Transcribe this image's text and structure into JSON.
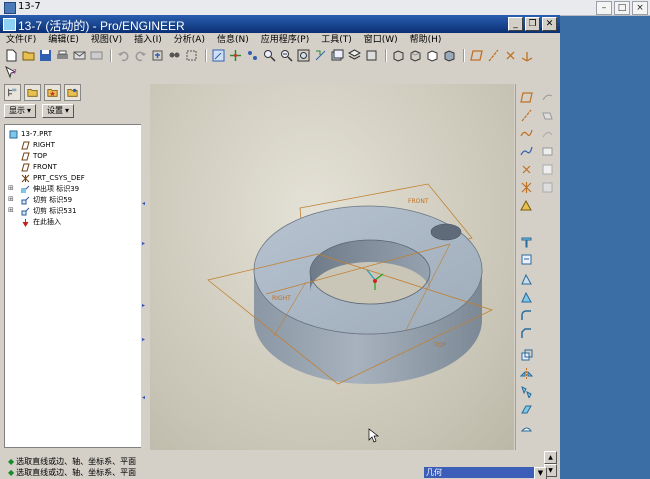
{
  "outer_window": {
    "title": "13-7"
  },
  "window": {
    "title": "13-7 (活动的) - Pro/ENGINEER"
  },
  "menu": [
    {
      "label": "文件(F)"
    },
    {
      "label": "编辑(E)"
    },
    {
      "label": "视图(V)"
    },
    {
      "label": "插入(I)"
    },
    {
      "label": "分析(A)"
    },
    {
      "label": "信息(N)"
    },
    {
      "label": "应用程序(P)"
    },
    {
      "label": "工具(T)"
    },
    {
      "label": "窗口(W)"
    },
    {
      "label": "帮助(H)"
    }
  ],
  "left_panel": {
    "display_button": "显示",
    "settings_button": "设置",
    "tree": [
      {
        "label": "13-7.PRT",
        "icon": "part-icon"
      },
      {
        "label": "RIGHT",
        "icon": "datum-plane-icon"
      },
      {
        "label": "TOP",
        "icon": "datum-plane-icon"
      },
      {
        "label": "FRONT",
        "icon": "datum-plane-icon"
      },
      {
        "label": "PRT_CSYS_DEF",
        "icon": "csys-icon"
      },
      {
        "label": "伸出项 标识39",
        "icon": "protrusion-icon"
      },
      {
        "label": "切剪 标识59",
        "icon": "cut-icon"
      },
      {
        "label": "切剪 标识531",
        "icon": "cut-icon"
      },
      {
        "label": "在此插入",
        "icon": "insert-here-icon"
      }
    ]
  },
  "viewport": {
    "datum_labels": {
      "front": "FRONT",
      "right": "RIGHT",
      "top": "TOP"
    }
  },
  "messages": [
    "选取直线或边、轴、坐标系、平面",
    "选取直线或边、轴、坐标系、平面"
  ],
  "status": {
    "filter": "几何"
  },
  "colors": {
    "part": "#9aaabb",
    "datum": "#c08030",
    "title_bar": "#0b2f74",
    "filter_bg": "#3d5eb8"
  }
}
